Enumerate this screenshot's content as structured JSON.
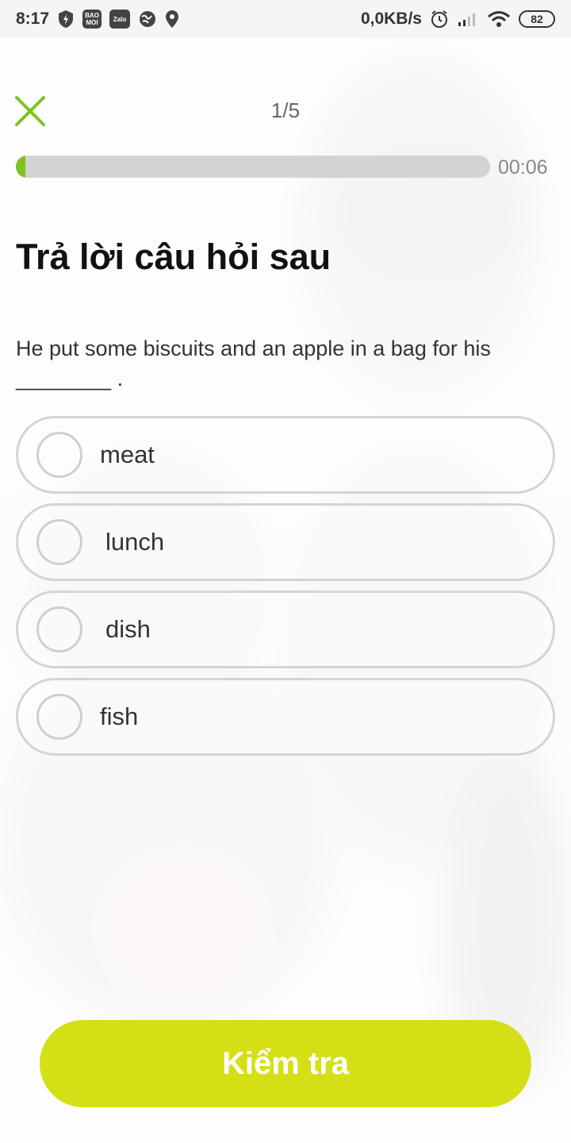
{
  "status_bar": {
    "time": "8:17",
    "badge_baomoi": "BAO MOI",
    "badge_zalo": "Zalo",
    "network_speed": "0,0KB/s",
    "battery": "82"
  },
  "quiz": {
    "counter": "1/5",
    "progress": 0.02,
    "timer": "00:06",
    "heading": "Trả lời câu hỏi sau",
    "question": "He put some biscuits and an apple in a bag for his ________ .",
    "options": [
      "meat",
      "lunch",
      "dish",
      "fish"
    ],
    "submit_label": "Kiểm tra"
  },
  "colors": {
    "accent_green": "#7cc421",
    "button_lime": "#d5df16"
  },
  "icons": {
    "close": "close-icon",
    "radio": "radio-unchecked-icon"
  }
}
